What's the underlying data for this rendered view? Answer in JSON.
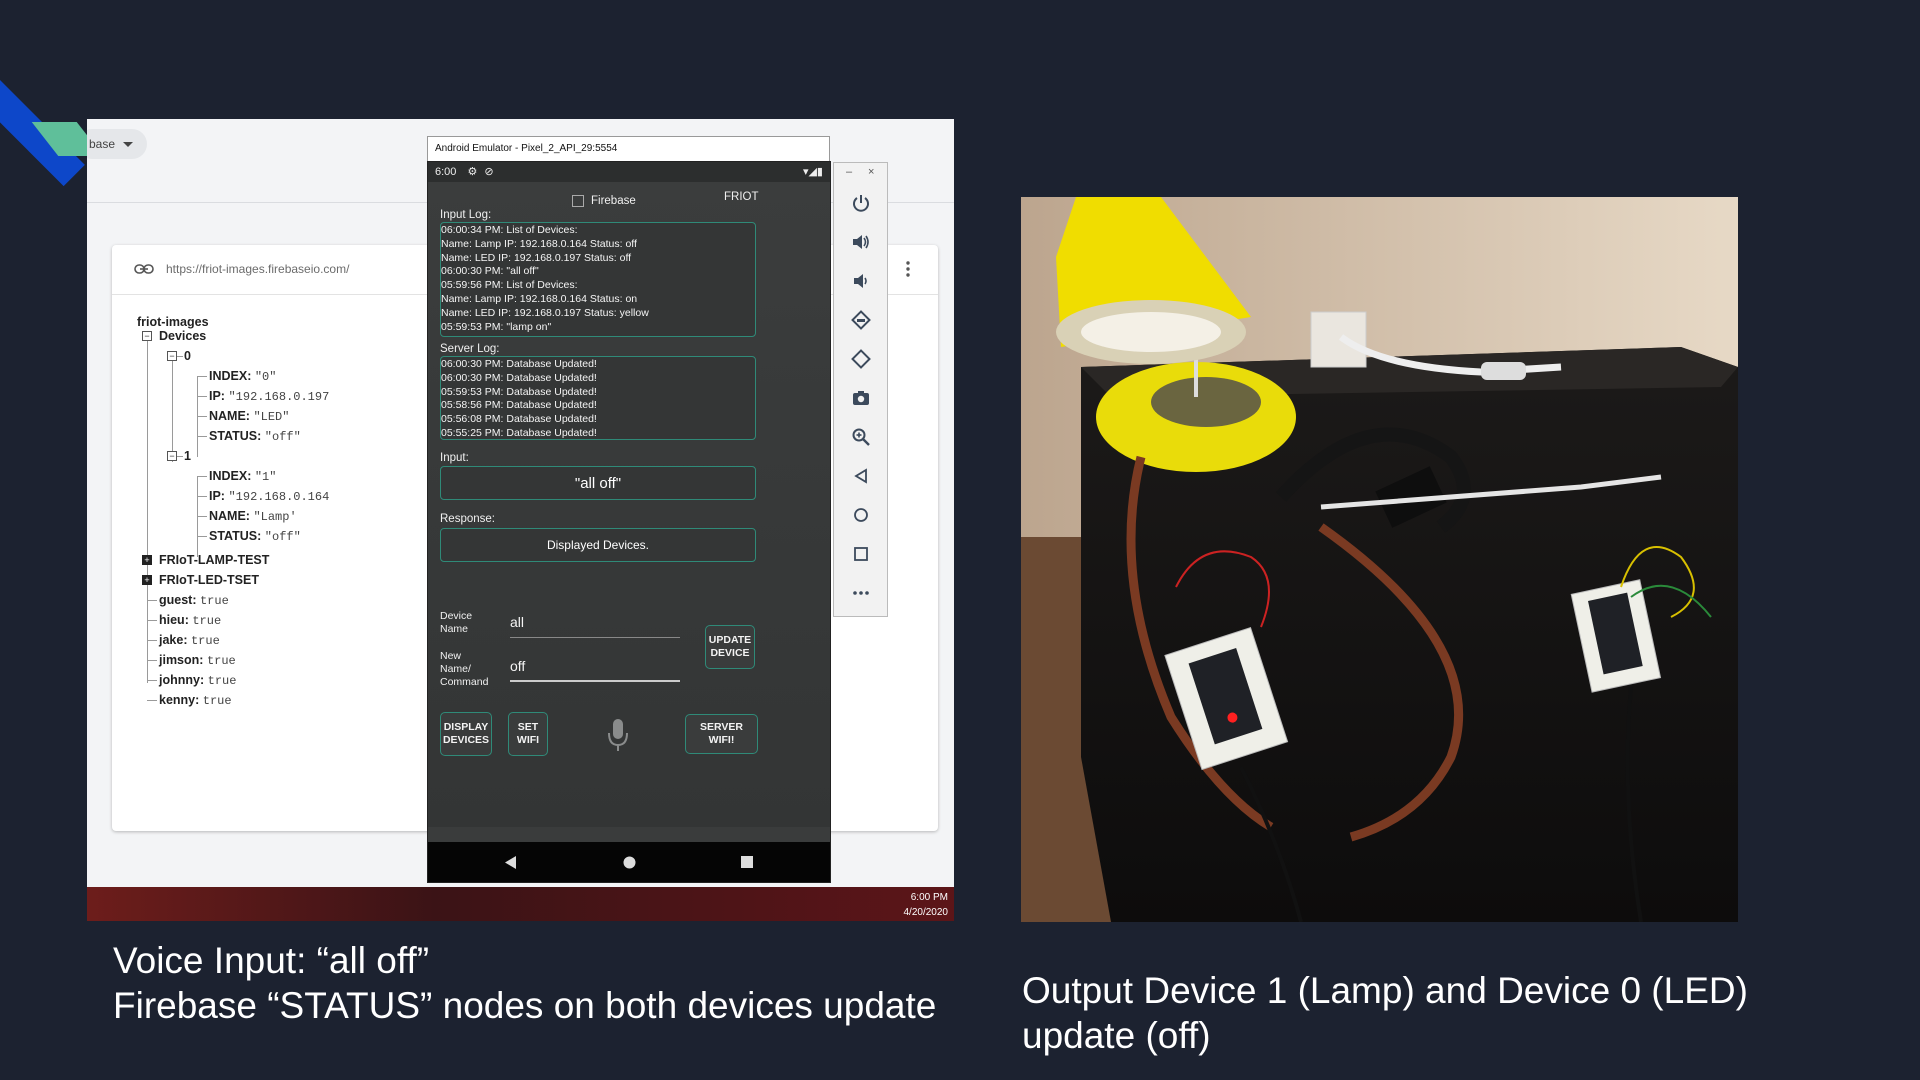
{
  "firebase": {
    "pill_label": "base",
    "url": "https://friot-images.firebaseio.com/",
    "root": "friot-images",
    "devices_label": "Devices",
    "device0": {
      "key": "0",
      "index_label": "INDEX:",
      "index": "\"0\"",
      "ip_label": "IP:",
      "ip": "\"192.168.0.197",
      "name_label": "NAME:",
      "name": "\"LED\"",
      "status_label": "STATUS:",
      "status": "\"off\""
    },
    "device1": {
      "key": "1",
      "index_label": "INDEX:",
      "index": "\"1\"",
      "ip_label": "IP:",
      "ip": "\"192.168.0.164",
      "name_label": "NAME:",
      "name": "\"Lamp'",
      "status_label": "STATUS:",
      "status": "\"off\""
    },
    "other_nodes": [
      "FRIoT-LAMP-TEST",
      "FRIoT-LED-TSET"
    ],
    "users": [
      {
        "name": "guest:",
        "value": "true"
      },
      {
        "name": "hieu:",
        "value": "true"
      },
      {
        "name": "jake:",
        "value": "true"
      },
      {
        "name": "jimson:",
        "value": "true"
      },
      {
        "name": "johnny:",
        "value": "true"
      },
      {
        "name": "kenny:",
        "value": "true"
      }
    ]
  },
  "taskbar": {
    "time": "6:00 PM",
    "date": "4/20/2020"
  },
  "emulator": {
    "window_title": "Android Emulator - Pixel_2_API_29:5554",
    "status_time": "6:00",
    "app_title": "FRIOT",
    "firebase_checkbox_label": "Firebase",
    "input_log_label": "Input Log:",
    "input_log": [
      "06:00:34 PM: List of Devices:",
      "Name: Lamp  IP: 192.168.0.164  Status: off",
      "Name: LED  IP: 192.168.0.197  Status: off",
      "06:00:30 PM: \"all off\"",
      "05:59:56 PM: List of Devices:",
      "Name: Lamp  IP: 192.168.0.164  Status: on",
      "Name: LED  IP: 192.168.0.197  Status: yellow",
      "05:59:53 PM: \"lamp on\""
    ],
    "server_log_label": "Server Log:",
    "server_log": [
      "06:00:30 PM: Database Updated!",
      "06:00:30 PM: Database Updated!",
      "05:59:53 PM: Database Updated!",
      "05:58:56 PM: Database Updated!",
      "05:56:08 PM: Database Updated!",
      "05:55:25 PM: Database Updated!"
    ],
    "input_label": "Input:",
    "input_value": "\"all off\"",
    "response_label": "Response:",
    "response_value": "Displayed Devices.",
    "device_name_label": "Device\nName",
    "device_name_value": "all",
    "new_name_label": "New\nName/\nCommand",
    "new_name_value": "off",
    "update_button": "UPDATE\nDEVICE",
    "display_button": "DISPLAY\nDEVICES",
    "set_wifi_button": "SET\nWIFI",
    "server_wifi_button": "SERVER WIFI!"
  },
  "captions": {
    "left_line1": "Voice Input: “all off”",
    "left_line2": "Firebase “STATUS” nodes on both devices update",
    "right": "Output Device 1 (Lamp) and Device 0 (LED) update (off)"
  }
}
